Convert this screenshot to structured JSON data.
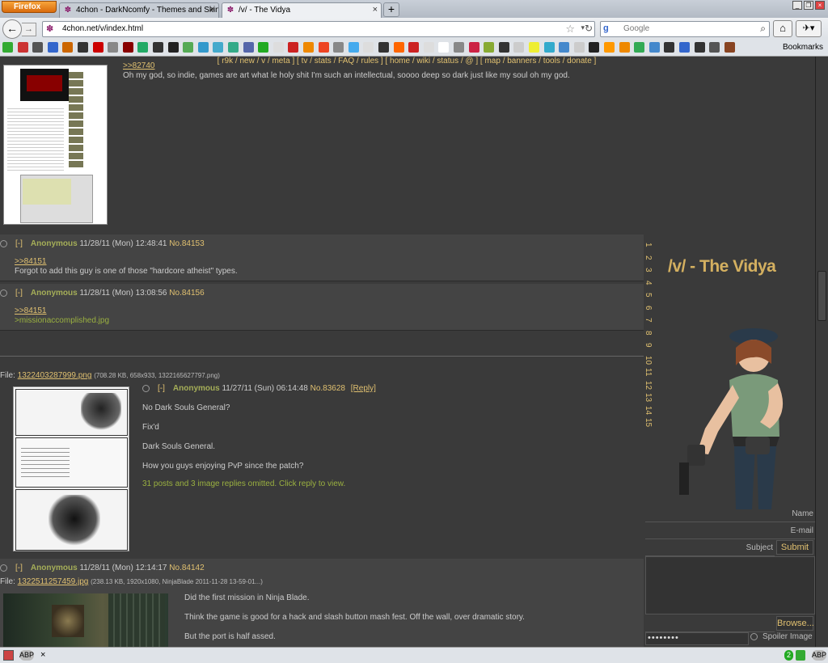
{
  "browser": {
    "app_button": "Firefox",
    "tabs": [
      {
        "label": "4chon - DarkNcomfy - Themes and Skins ...",
        "active": false
      },
      {
        "label": "/v/ - The Vidya",
        "active": true
      }
    ],
    "new_tab": "+",
    "url": "4chon.net/v/index.html",
    "search_engine": "Google",
    "search_placeholder": "Google",
    "bookmarks_label": "Bookmarks"
  },
  "board": {
    "nav_text": "[ r9k / new / v / meta ] [ tv / stats / FAQ / rules ] [ home / wiki / status / @ ] [ map / banners / tools / donate ]",
    "title": "/v/ - The Vidya",
    "page_numbers": [
      "1",
      "2",
      "3",
      "4",
      "5",
      "6",
      "7",
      "8",
      "9",
      "10",
      "11",
      "12",
      "13",
      "14",
      "15"
    ]
  },
  "posts": {
    "top_ref": ">>82740",
    "top_text": "Oh my god, so indie, games are art what le holy shit I'm such an intellectual, soooo deep so dark just like my soul oh my god.",
    "reply1": {
      "minus": "[-]",
      "name": "Anonymous",
      "date": "11/28/11 (Mon) 12:48:41",
      "num": "No.84153",
      "ref": ">>84151",
      "text": "Forgot to add this guy is one of those \"hardcore atheist\" types."
    },
    "reply2": {
      "minus": "[-]",
      "name": "Anonymous",
      "date": "11/28/11 (Mon) 13:08:56",
      "num": "No.84156",
      "ref": ">>84151",
      "greentext": ">missionaccomplished.jpg"
    },
    "thread": {
      "file_prefix": "File: ",
      "file_name": "1322403287999.png",
      "file_info": "(708.28 KB, 658x933, 1322165627797.png)",
      "minus": "[-]",
      "name": "Anonymous",
      "date": "11/27/11 (Sun) 06:14:48",
      "num": "No.83628",
      "reply_link": "[Reply]",
      "lines": [
        "No Dark Souls General?",
        "Fix'd",
        "Dark Souls General.",
        "How you guys enjoying PvP since the patch?"
      ],
      "omitted": "31 posts and 3 image replies omitted. Click reply to view."
    },
    "reply3": {
      "minus": "[-]",
      "name": "Anonymous",
      "date": "11/28/11 (Mon) 12:14:17",
      "num": "No.84142",
      "file_prefix": "File: ",
      "file_name": "1322511257459.jpg",
      "file_info": "(238.13 KB, 1920x1080, NinjaBlade 2011-11-28 13-59-01...)",
      "lines": [
        "Did the first mission in Ninja Blade.",
        "Think the game is good for a hack and slash button mash fest. Off the wall, over dramatic story.",
        "But the port is half assed."
      ]
    }
  },
  "form": {
    "name_label": "Name",
    "email_label": "E-mail",
    "subject_label": "Subject",
    "submit": "Submit",
    "browse": "Browse...",
    "password": "••••••••",
    "spoiler": "Spoiler Image"
  },
  "colors": {
    "accent": "#e0c070",
    "name": "#a5ae58",
    "greentext": "#9ab040",
    "background": "#3a3a3a"
  }
}
